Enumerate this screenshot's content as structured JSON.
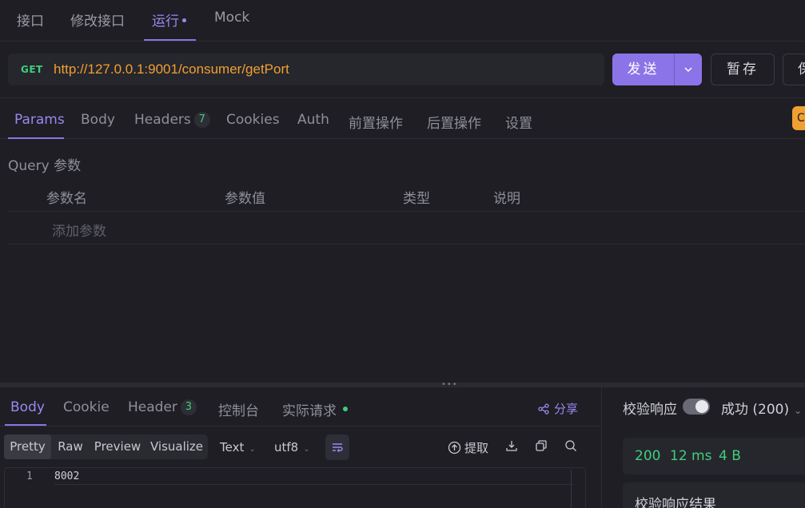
{
  "top_tabs": [
    {
      "label": "接口"
    },
    {
      "label": "修改接口"
    },
    {
      "label": "运行"
    },
    {
      "label": "Mock"
    }
  ],
  "request": {
    "method": "GET",
    "url": "http://127.0.0.1:9001/consumer/getPort",
    "send_label": "发送",
    "save_label": "暂存",
    "more_label": "保"
  },
  "request_tabs": [
    {
      "label": "Params"
    },
    {
      "label": "Body"
    },
    {
      "label": "Headers",
      "count": "7"
    },
    {
      "label": "Cookies"
    },
    {
      "label": "Auth"
    },
    {
      "label": "前置操作"
    },
    {
      "label": "后置操作"
    },
    {
      "label": "设置"
    }
  ],
  "orange_tag": "C",
  "query": {
    "title": "Query 参数",
    "columns": [
      "参数名",
      "参数值",
      "类型",
      "说明"
    ],
    "add_placeholder": "添加参数"
  },
  "response_tabs": [
    {
      "label": "Body"
    },
    {
      "label": "Cookie"
    },
    {
      "label": "Header",
      "count": "3"
    },
    {
      "label": "控制台"
    },
    {
      "label": "实际请求"
    }
  ],
  "share_label": "分享",
  "format": {
    "modes": [
      "Pretty",
      "Raw",
      "Preview",
      "Visualize"
    ],
    "active_mode": "Pretty",
    "type": "Text",
    "encoding": "utf8",
    "extract_label": "提取"
  },
  "body_lines": [
    {
      "no": "1",
      "text": "8002"
    }
  ],
  "right_panel": {
    "validate_label": "校验响应",
    "validate_enabled": true,
    "status_label": "成功 (200)",
    "status_code": "200",
    "time": "12 ms",
    "size": "4 B",
    "result_title": "校验响应结果"
  },
  "colors": {
    "accent": "#8b74e8",
    "success": "#3ecf7a",
    "url": "#f0a030",
    "background": "#1e1e24"
  }
}
